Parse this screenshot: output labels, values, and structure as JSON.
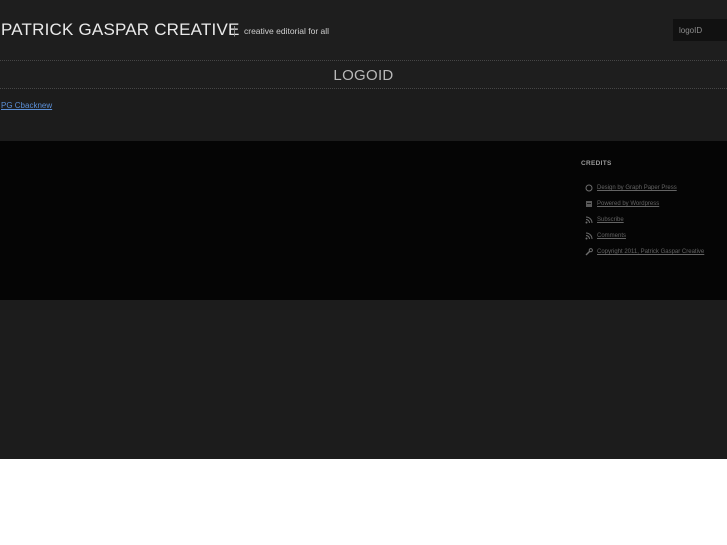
{
  "header": {
    "site_title": "PATRICK GASPAR CREATIVE",
    "separator": "|",
    "tagline": "creative editorial for all"
  },
  "search": {
    "value": "logoID"
  },
  "page": {
    "title": "LOGOID"
  },
  "content": {
    "link_text": "PG Cbacknew"
  },
  "footer": {
    "heading": "CREDITS",
    "items": [
      {
        "icon": "circle-icon",
        "label": "Design by Graph Paper Press"
      },
      {
        "icon": "wordpress-icon",
        "label": "Powered by Wordpress"
      },
      {
        "icon": "rss-icon",
        "label": "Subscribe"
      },
      {
        "icon": "rss-icon",
        "label": "Comments"
      },
      {
        "icon": "wrench-icon",
        "label": "Copyright 2011, Patrick Gaspar Creative"
      }
    ]
  }
}
